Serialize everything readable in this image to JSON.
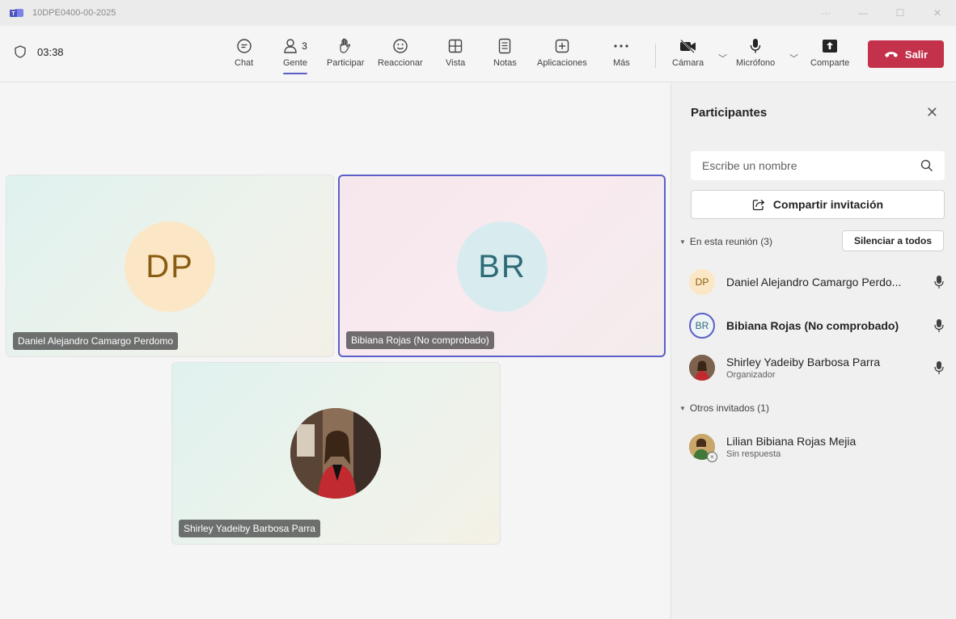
{
  "window": {
    "title": "10DPE0400-00-2025",
    "more": "···"
  },
  "toolbar": {
    "timer": "03:38",
    "buttons": [
      {
        "label": "Chat",
        "icon": "chat-icon"
      },
      {
        "label": "Gente",
        "icon": "people-icon",
        "badge": "3"
      },
      {
        "label": "Participar",
        "icon": "raise-hand-icon"
      },
      {
        "label": "Reaccionar",
        "icon": "smiley-icon"
      },
      {
        "label": "Vista",
        "icon": "view-grid-icon"
      },
      {
        "label": "Notas",
        "icon": "notes-icon"
      },
      {
        "label": "Aplicaciones",
        "icon": "add-app-icon"
      },
      {
        "label": "Más",
        "icon": "more-icon"
      }
    ],
    "camera_label": "Cámara",
    "mic_label": "Micrófono",
    "share_label": "Comparte",
    "leave_label": "Salir",
    "leave_color": "#c4314b",
    "accent_color": "#5b5fc7"
  },
  "stage": {
    "tiles": [
      {
        "initials": "DP",
        "name": "Daniel Alejandro Camargo Perdomo",
        "avatar_bg": "#fbe7c6",
        "avatar_fg": "#8a5b12"
      },
      {
        "initials": "BR",
        "name": "Bibiana Rojas (No comprobado)",
        "avatar_bg": "#d8ecef",
        "avatar_fg": "#2d6b78",
        "speaking": true
      },
      {
        "name": "Shirley Yadeiby Barbosa Parra",
        "photo": true
      }
    ]
  },
  "panel": {
    "title": "Participantes",
    "search_placeholder": "Escribe un nombre",
    "invite_label": "Compartir invitación",
    "in_meeting_label": "En esta reunión (3)",
    "mute_all_label": "Silenciar a todos",
    "others_label": "Otros invitados (1)",
    "participants": [
      {
        "initials": "DP",
        "name": "Daniel Alejandro Camargo Perdo...",
        "role": ""
      },
      {
        "initials": "BR",
        "name": "Bibiana Rojas (No comprobado)",
        "role": ""
      },
      {
        "initials": "",
        "name": "Shirley Yadeiby Barbosa Parra",
        "role": "Organizador"
      }
    ],
    "others": [
      {
        "name": "Lilian Bibiana Rojas Mejia",
        "status": "Sin respuesta"
      }
    ]
  }
}
